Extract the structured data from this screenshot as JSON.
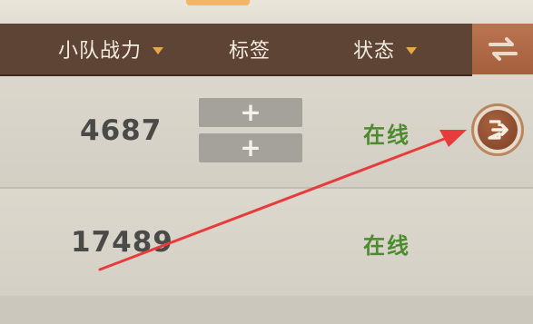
{
  "header": {
    "columns": [
      {
        "label": "小队战力",
        "has_dropdown": true
      },
      {
        "label": "标签",
        "has_dropdown": false
      },
      {
        "label": "状态",
        "has_dropdown": true
      }
    ],
    "switch_icon": "swap-arrows-icon"
  },
  "rows": [
    {
      "power": "4687",
      "tag_buttons": [
        "+",
        "+"
      ],
      "status": "在线",
      "action_icon": "exit-door-icon"
    },
    {
      "power": "17489",
      "status": "在线"
    }
  ],
  "colors": {
    "header_bg": "#5e4435",
    "accent": "#e7a843",
    "online": "#4c8b2f",
    "annotation_arrow": "#e83c3c"
  }
}
